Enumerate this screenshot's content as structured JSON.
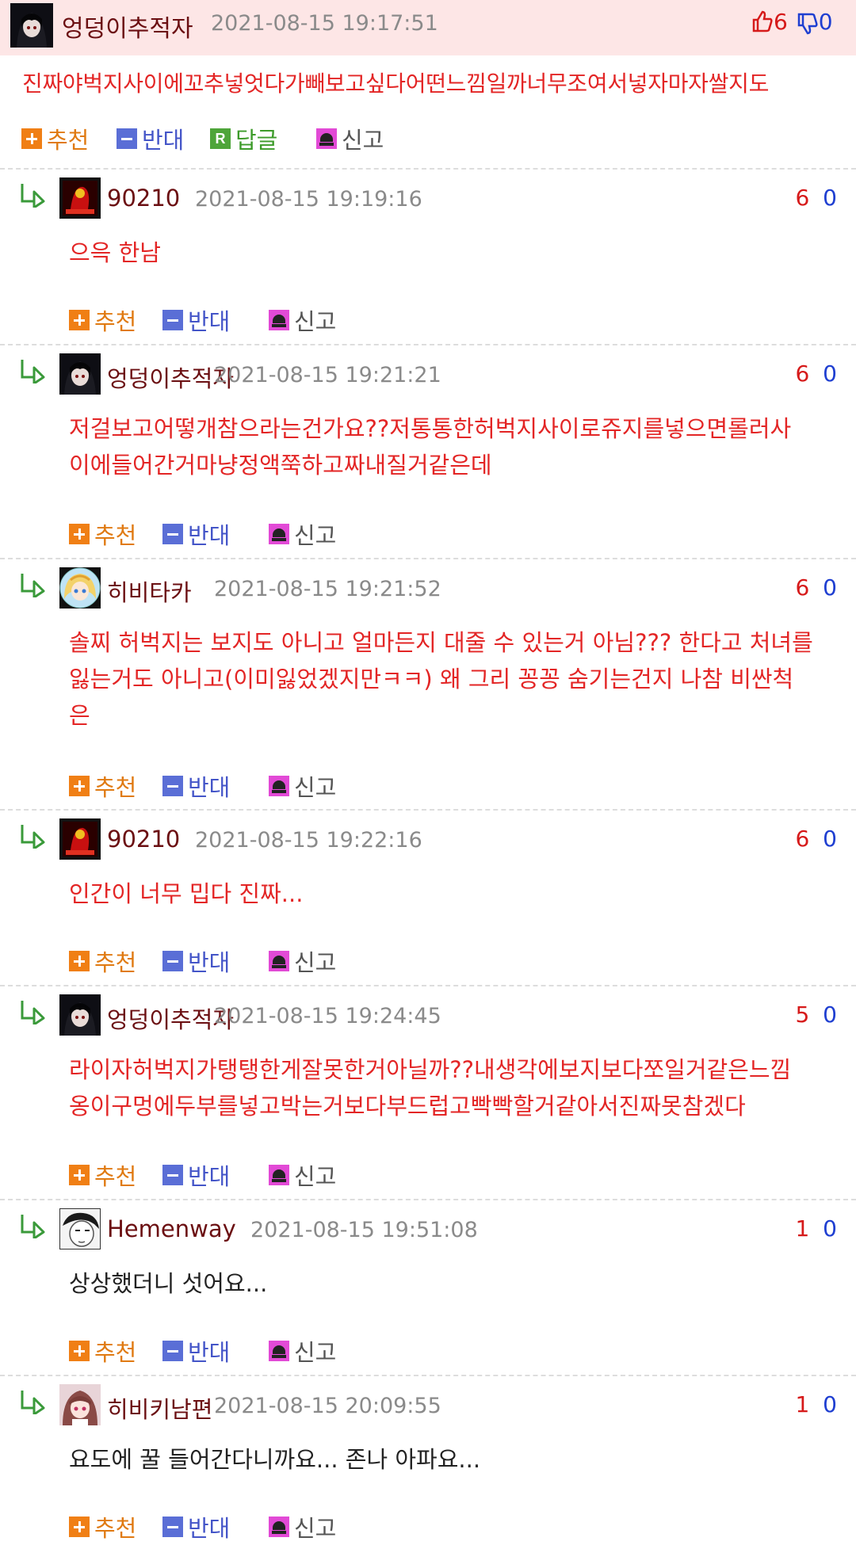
{
  "post": {
    "username": "엉덩이추적자",
    "timestamp": "2021-08-15 19:17:51",
    "up": "6",
    "down": "0",
    "text": "진짜야벅지사이에꼬추넣엇다가빼보고싶다어떤느낌일까너무조여서넣자마자쌀지도",
    "actions": {
      "recommend": "추천",
      "oppose": "반대",
      "reply": "답글",
      "report": "신고"
    }
  },
  "actions": {
    "recommend": "추천",
    "oppose": "반대",
    "report": "신고"
  },
  "replies": [
    {
      "username": "90210",
      "timestamp": "2021-08-15 19:19:16",
      "up": "6",
      "down": "0",
      "lines": [
        "으윽 한남"
      ],
      "avatar": "hell-icon",
      "color": "red"
    },
    {
      "username": "엉덩이추적자",
      "timestamp": "2021-08-15 19:21:21",
      "up": "6",
      "down": "0",
      "lines": [
        "저걸보고어떻개참으라는건가요??저통통한허벅지사이로쥬지를넣으면롤러사",
        "이에들어간거마냥정액쭉하고짜내질거같은데"
      ],
      "avatar": "dark-hair-icon",
      "color": "red"
    },
    {
      "username": "히비타카",
      "timestamp": "2021-08-15 19:21:52",
      "up": "6",
      "down": "0",
      "lines": [
        "솔찌 허벅지는 보지도 아니고 얼마든지 대줄 수 있는거 아님??? 한다고 처녀를",
        "잃는거도 아니고(이미잃었겠지만ㅋㅋ) 왜 그리 꽁꽁 숨기는건지 나참 비싼척",
        "은"
      ],
      "avatar": "blonde-icon",
      "color": "red"
    },
    {
      "username": "90210",
      "timestamp": "2021-08-15 19:22:16",
      "up": "6",
      "down": "0",
      "lines": [
        "인간이 너무 밉다 진짜..."
      ],
      "avatar": "hell-icon",
      "color": "red"
    },
    {
      "username": "엉덩이추적자",
      "timestamp": "2021-08-15 19:24:45",
      "up": "5",
      "down": "0",
      "lines": [
        "라이자허벅지가탱탱한게잘못한거아닐까??내생각에보지보다쪼일거같은느낌",
        "옹이구멍에두부를넣고박는거보다부드럽고빡빡할거같아서진짜못참겠다"
      ],
      "avatar": "dark-hair-icon",
      "color": "red"
    },
    {
      "username": "Hemenway",
      "timestamp": "2021-08-15 19:51:08",
      "up": "1",
      "down": "0",
      "lines": [
        "상상했더니 섯어요..."
      ],
      "avatar": "sketch-face-icon",
      "color": "black"
    },
    {
      "username": "히비키남편",
      "timestamp": "2021-08-15 20:09:55",
      "up": "1",
      "down": "0",
      "lines": [
        "요도에 꿀 들어간다니까요... 존나 아파요..."
      ],
      "avatar": "anime-girl-icon",
      "color": "black"
    }
  ]
}
